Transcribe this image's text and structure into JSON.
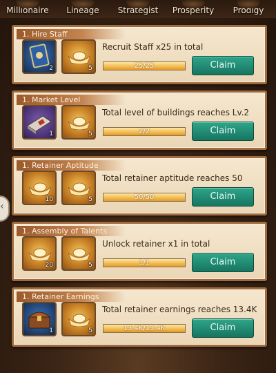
{
  "tabs": [
    {
      "label": "Millionaire"
    },
    {
      "label": "Lineage"
    },
    {
      "label": "Strategist"
    },
    {
      "label": "Prosperity"
    },
    {
      "label": "Prodigy"
    }
  ],
  "quests": [
    {
      "tag": "1. Hire Staff",
      "description": "Recruit Staff x25 in total",
      "progress_text": "25/25",
      "progress": 1.0,
      "claim_label": "Claim",
      "rewards": [
        {
          "icon": "staff-card-icon",
          "count": "2"
        },
        {
          "icon": "gold-ingot-icon",
          "count": "5"
        }
      ]
    },
    {
      "tag": "1. Market Level",
      "description": "Total level of buildings reaches Lv.2",
      "progress_text": "2/2",
      "progress": 1.0,
      "claim_label": "Claim",
      "rewards": [
        {
          "icon": "book-icon",
          "count": "1"
        },
        {
          "icon": "gold-ingot-icon",
          "count": "5"
        }
      ]
    },
    {
      "tag": "1. Retainer Aptitude",
      "description": "Total retainer aptitude reaches 50",
      "progress_text": "50/50",
      "progress": 1.0,
      "claim_label": "Claim",
      "rewards": [
        {
          "icon": "gold-ingot-icon",
          "count": "10"
        },
        {
          "icon": "gold-ingot-icon",
          "count": "5"
        }
      ]
    },
    {
      "tag": "1. Assembly of Talents",
      "description": "Unlock  retainer x1 in total",
      "progress_text": "1/1",
      "progress": 1.0,
      "claim_label": "Claim",
      "rewards": [
        {
          "icon": "gold-ingot-icon",
          "count": "20"
        },
        {
          "icon": "gold-ingot-icon",
          "count": "5"
        }
      ]
    },
    {
      "tag": "1. Retainer Earnings",
      "description": "Total retainer earnings reaches 13.4K",
      "progress_text": "13.4K/13.4K",
      "progress": 1.0,
      "claim_label": "Claim",
      "rewards": [
        {
          "icon": "treasure-chest-icon",
          "count": "1"
        },
        {
          "icon": "gold-ingot-icon",
          "count": "5"
        }
      ]
    }
  ],
  "colors": {
    "claim": "#1f8a70",
    "progress": "#f1b94f",
    "card": "#f2e2c6"
  }
}
